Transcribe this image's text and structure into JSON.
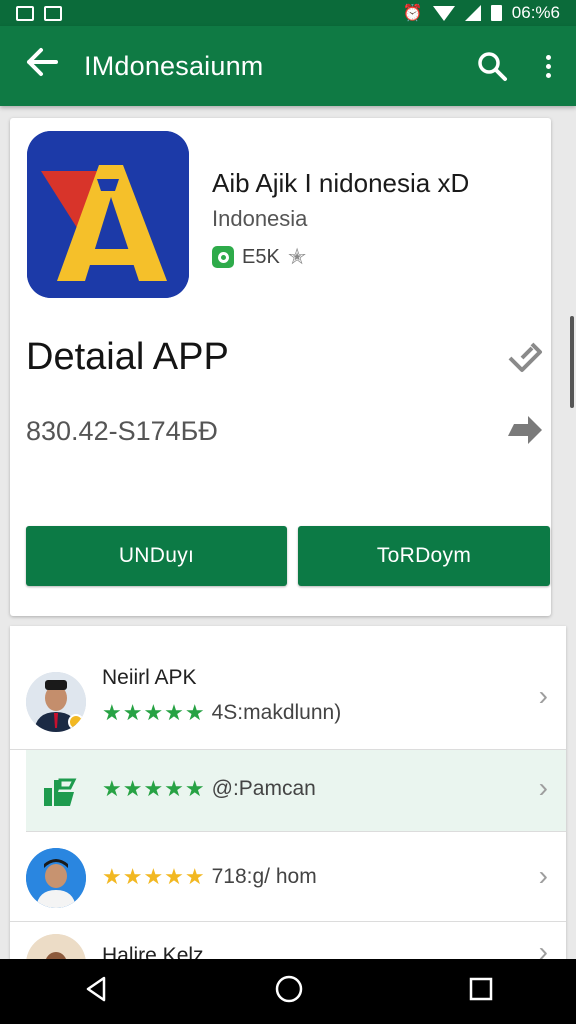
{
  "status_bar": {
    "time": "06:%6",
    "left_icons": [
      "gallery-icon",
      "photo-icon"
    ],
    "right_icons": [
      "alarm-icon",
      "wifi-icon",
      "signal-icon",
      "battery-icon"
    ]
  },
  "app_bar": {
    "title": "IMdonesaiunm",
    "back_icon": "arrow-back-icon",
    "search_icon": "search-icon",
    "more_icon": "more-vert-icon",
    "color": "#0f7a44"
  },
  "app": {
    "name": "Aib Ajik I nidonesia хD",
    "developer": "Indonesia",
    "rating_text": "E5K",
    "icon_letter": "A",
    "detail_title": "Detaial APP",
    "size_text": "830.42-S174БĐ",
    "buttons": {
      "download": "UNDuyı",
      "other": "ToRDoym"
    }
  },
  "list": [
    {
      "title": "Neiirl APK",
      "stars": "★★★★★",
      "text": "4S:makdlunn)",
      "star_color": "#27a244"
    },
    {
      "title": "",
      "stars": "★★★★★",
      "text": "@:Pamcan",
      "star_color": "#27a244"
    },
    {
      "title": "",
      "stars": "★★★★★",
      "text": "718:g/ hom",
      "star_color": "#f2b822"
    },
    {
      "title": "Halire Kelz",
      "stars": "",
      "text": ""
    }
  ],
  "nav": {
    "back": "nav-back-icon",
    "home": "nav-home-icon",
    "recents": "nav-recents-icon"
  },
  "colors": {
    "primary": "#0f7a44",
    "button": "#0c7a45",
    "highlight_row": "#eaf5ef"
  }
}
